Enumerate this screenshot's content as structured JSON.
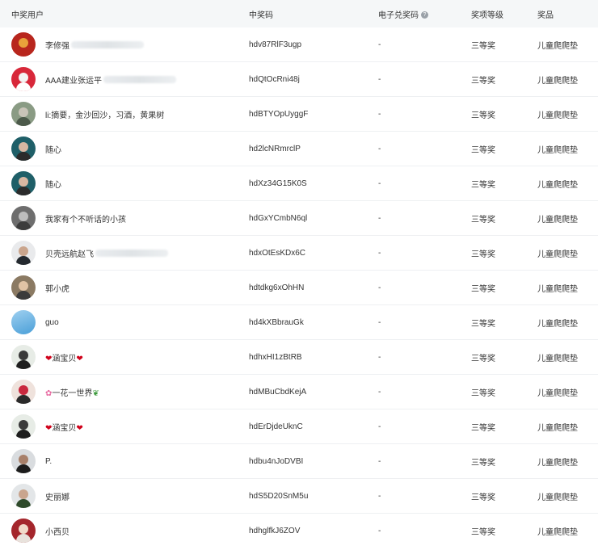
{
  "header": {
    "user": "中奖用户",
    "code": "中奖码",
    "ecode": "电子兑奖码",
    "ecode_info_icon": "question-circle-icon",
    "level": "奖项等级",
    "prize": "奖品"
  },
  "rows": [
    {
      "name": "李修强",
      "code": "hdv87RlF3ugp",
      "ecode": "-",
      "level": "三等奖",
      "prize": "儿童爬爬垫"
    },
    {
      "name": "AAA建业张运平",
      "code": "hdQtOcRni48j",
      "ecode": "-",
      "level": "三等奖",
      "prize": "儿童爬爬垫"
    },
    {
      "name": "li:摘要，金沙回沙，习酒，黄果树",
      "code": "hdBTYOpUyggF",
      "ecode": "-",
      "level": "三等奖",
      "prize": "儿童爬爬垫"
    },
    {
      "name": "随心",
      "code": "hd2lcNRmrclP",
      "ecode": "-",
      "level": "三等奖",
      "prize": "儿童爬爬垫"
    },
    {
      "name": "随心",
      "code": "hdXz34G15K0S",
      "ecode": "-",
      "level": "三等奖",
      "prize": "儿童爬爬垫"
    },
    {
      "name": "我家有个不听话的小孩",
      "code": "hdGxYCmbN6ql",
      "ecode": "-",
      "level": "三等奖",
      "prize": "儿童爬爬垫"
    },
    {
      "name": "贝壳远航赵飞",
      "code": "hdxOtEsKDx6C",
      "ecode": "-",
      "level": "三等奖",
      "prize": "儿童爬爬垫"
    },
    {
      "name": "郭小虎",
      "code": "hdtdkg6xOhHN",
      "ecode": "-",
      "level": "三等奖",
      "prize": "儿童爬爬垫"
    },
    {
      "name": "guo",
      "code": "hd4kXBbrauGk",
      "ecode": "-",
      "level": "三等奖",
      "prize": "儿童爬爬垫"
    },
    {
      "name": "涵宝贝",
      "code": "hdhxHI1zBtRB",
      "ecode": "-",
      "level": "三等奖",
      "prize": "儿童爬爬垫"
    },
    {
      "name": "一花一世界",
      "code": "hdMBuCbdKejA",
      "ecode": "-",
      "level": "三等奖",
      "prize": "儿童爬爬垫"
    },
    {
      "name": "涵宝贝",
      "code": "hdErDjdeUknC",
      "ecode": "-",
      "level": "三等奖",
      "prize": "儿童爬爬垫"
    },
    {
      "name": "P.",
      "code": "hdbu4nJoDVBI",
      "ecode": "-",
      "level": "三等奖",
      "prize": "儿童爬爬垫"
    },
    {
      "name": "史丽娜",
      "code": "hdS5D20SnM5u",
      "ecode": "-",
      "level": "三等奖",
      "prize": "儿童爬爬垫"
    },
    {
      "name": "小西贝",
      "code": "hdhglfkJ6ZOV",
      "ecode": "-",
      "level": "三等奖",
      "prize": "儿童爬爬垫"
    }
  ]
}
